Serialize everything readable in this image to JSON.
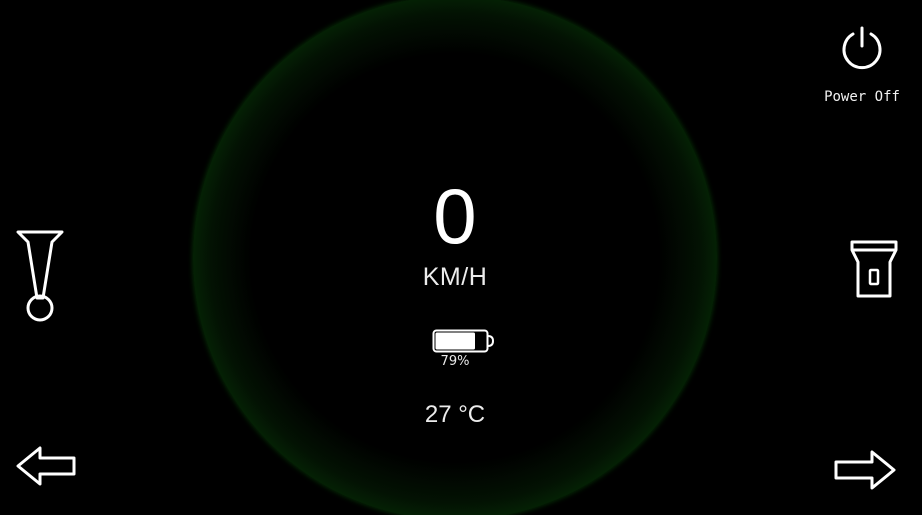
{
  "dashboard": {
    "speed": "0",
    "speed_unit": "KM/H",
    "battery": {
      "label": "79%",
      "level": 0.79
    },
    "temperature": "27 °C"
  },
  "controls": {
    "power_label": "Power Off",
    "icons": {
      "power": "power-icon",
      "horn": "horn-icon",
      "headlight": "flashlight-icon",
      "left": "left-arrow-icon",
      "right": "right-arrow-icon"
    }
  },
  "colors": {
    "background": "#000000",
    "gauge_ring": "#16b916",
    "text": "#ffffff"
  }
}
